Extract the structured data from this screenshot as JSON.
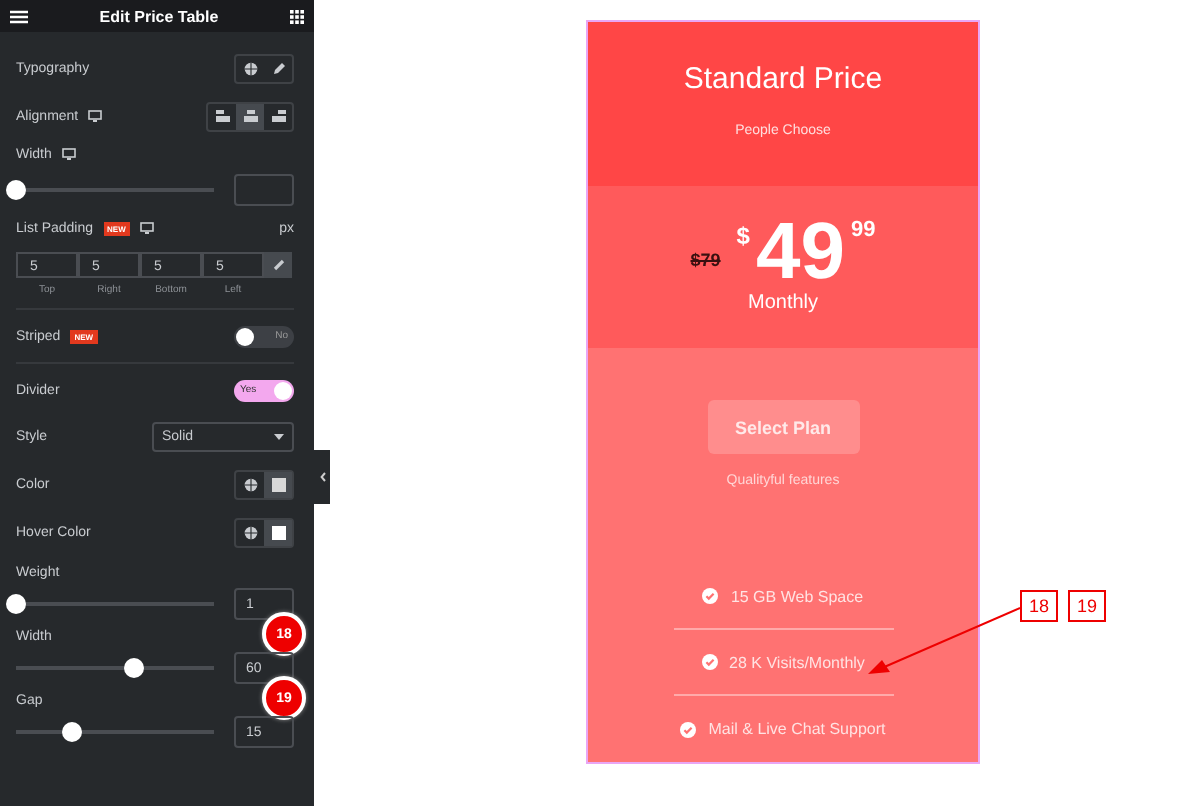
{
  "panel": {
    "title": "Edit Price Table",
    "controls": [
      {
        "kind": "icons",
        "label": "Typography"
      },
      {
        "kind": "align",
        "label": "Alignment",
        "options": [
          {
            "selected": false
          },
          {
            "selected": true
          },
          {
            "selected": false
          }
        ]
      },
      {
        "kind": "label",
        "label": "Width"
      },
      {
        "kind": "slider",
        "level": 0
      },
      {
        "kind": "label",
        "label": "List Padding",
        "badge": "NEW",
        "unit": "px"
      },
      {
        "kind": "padding",
        "fields": [
          {
            "value": "5",
            "caption": "Top"
          },
          {
            "value": "5",
            "caption": "Right"
          },
          {
            "value": "5",
            "caption": "Bottom"
          },
          {
            "value": "5",
            "caption": "Left"
          }
        ]
      },
      {
        "kind": "toggle",
        "label": "Striped",
        "badge": "NEW",
        "on": false,
        "text": "No"
      },
      {
        "kind": "toggle",
        "label": "Divider",
        "on": true,
        "text": "Yes"
      },
      {
        "kind": "select",
        "label": "Style",
        "value": "Solid"
      },
      {
        "kind": "color",
        "label": "Color"
      },
      {
        "kind": "color",
        "label": "Hover Color"
      },
      {
        "kind": "plain",
        "label": "Weight"
      },
      {
        "kind": "slider",
        "level": 0,
        "value": "1"
      },
      {
        "kind": "plain",
        "label": "Width",
        "marker": "18"
      },
      {
        "kind": "slider",
        "level": 0.6,
        "value": "60"
      },
      {
        "kind": "plain",
        "label": "Gap",
        "marker": "19"
      },
      {
        "kind": "slider",
        "level": 0.28,
        "value": "15"
      }
    ]
  },
  "card": {
    "title": "Standard Price",
    "subtitle": "People Choose",
    "old_price": "$79",
    "currency": "$",
    "amount": "49",
    "cents": "99",
    "period": "Monthly",
    "button": "Select Plan",
    "features_title": "Qualityful features",
    "features": [
      "15 GB Web Space",
      "28 K Visits/Monthly",
      "Mail & Live Chat Support"
    ]
  },
  "callout": [
    "18",
    "19"
  ]
}
